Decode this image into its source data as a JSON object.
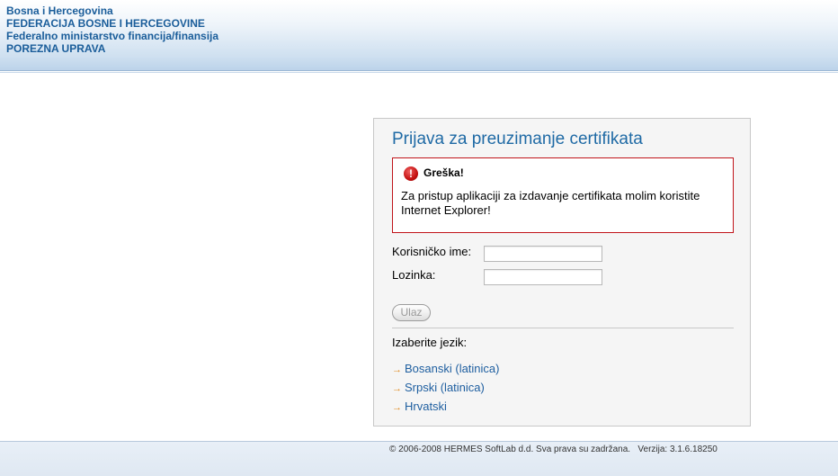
{
  "header": {
    "line1": "Bosna i Hercegovina",
    "line2": "FEDERACIJA BOSNE I HERCEGOVINE",
    "line3": "Federalno ministarstvo financija/finansija",
    "line4": "POREZNA UPRAVA"
  },
  "login": {
    "title": "Prijava za preuzimanje certifikata",
    "error": {
      "icon": "error-icon",
      "title": "Greška!",
      "message": "Za pristup aplikaciji za izdavanje certifikata molim koristite Internet Explorer!"
    },
    "username_label": "Korisničko ime:",
    "username_value": "",
    "password_label": "Lozinka:",
    "password_value": "",
    "submit_label": "Ulaz"
  },
  "language": {
    "title": "Izaberite jezik:",
    "arrow_icon": "arrow-right-icon",
    "items": [
      {
        "label": "Bosanski (latinica)"
      },
      {
        "label": "Srpski (latinica)"
      },
      {
        "label": "Hrvatski"
      }
    ]
  },
  "footer": {
    "copyright": "© 2006-2008 HERMES SoftLab d.d. Sva prava su zadržana.",
    "version": "Verzija: 3.1.6.18250"
  },
  "colors": {
    "accent_blue": "#1f6aa5",
    "error_red": "#c0141a",
    "link_blue": "#1f5fa0",
    "arrow_orange": "#e08a1e"
  }
}
